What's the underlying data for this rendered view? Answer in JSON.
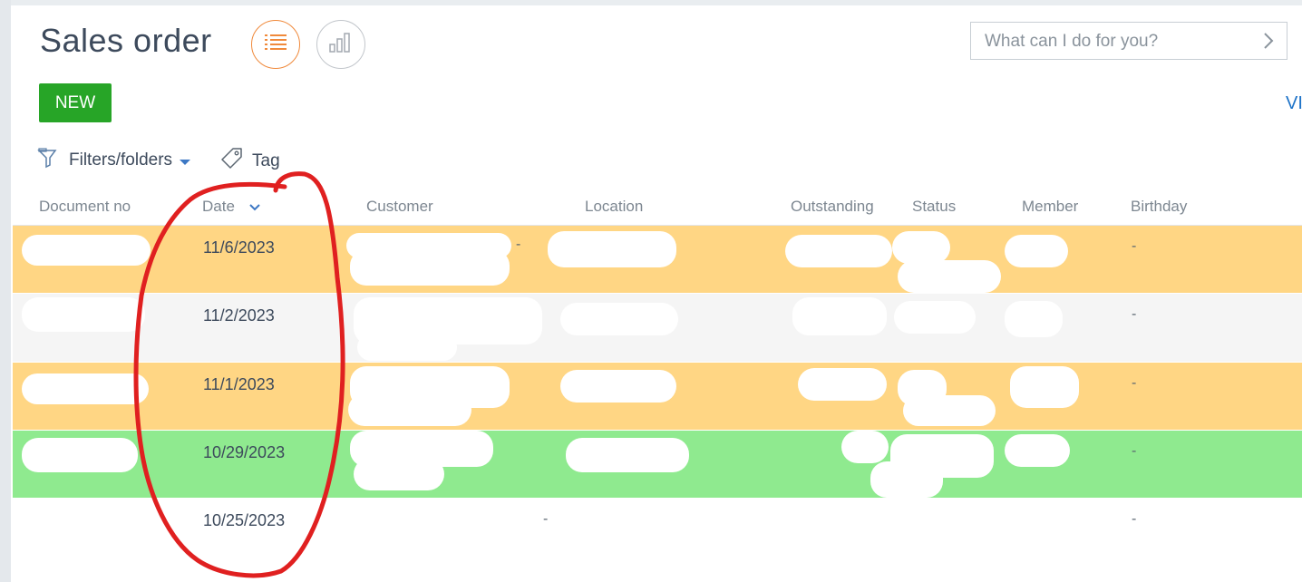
{
  "page": {
    "title": "Sales order",
    "new_button": "NEW",
    "view_link": "VI",
    "search_placeholder": "What can I do for you?",
    "filters_label": "Filters/folders",
    "tag_label": "Tag"
  },
  "icons": {
    "list_view": "list-view-icon",
    "chart_view": "chart-view-icon",
    "search_chevron": "chevron-right-icon",
    "filter": "filter-folder-icon",
    "tag": "tag-icon",
    "sort": "sort-down-icon"
  },
  "columns": [
    "Document no",
    "Date",
    "Customer",
    "Location",
    "Outstanding",
    "Status",
    "Member",
    "Birthday"
  ],
  "rows": [
    {
      "date": "11/6/2023",
      "customer_extra": "-",
      "birthday": "-",
      "color": "#ffd684"
    },
    {
      "date": "11/2/2023",
      "birthday": "-",
      "color": "#f5f5f5"
    },
    {
      "date": "11/1/2023",
      "birthday": "-",
      "color": "#ffd684"
    },
    {
      "date": "10/29/2023",
      "birthday": "-",
      "color": "#8fea8f"
    },
    {
      "date": "10/25/2023",
      "customer": "-",
      "birthday": "-",
      "color": "#ffffff"
    }
  ],
  "colors": {
    "accent_orange": "#f08a3c",
    "new_green": "#27a527",
    "link_blue": "#1e73c8",
    "annotation_red": "#e02020"
  }
}
